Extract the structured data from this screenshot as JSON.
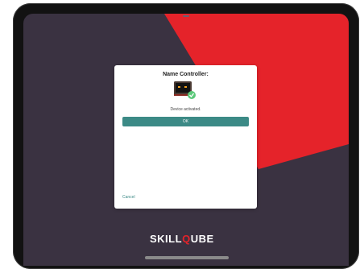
{
  "dialog": {
    "title": "Name Controller:",
    "status": "Device activated.",
    "ok_label": "OK",
    "cancel_label": "Cancel"
  },
  "brand": {
    "prefix": "SKILL",
    "q": "Q",
    "suffix": "UBE"
  },
  "colors": {
    "screen_background": "#3a3241",
    "accent_red": "#e5232a",
    "button_teal": "#3c8a86",
    "check_green": "#5cc97a"
  },
  "icons": {
    "controller": "controller-device-icon",
    "check": "check-circle-icon"
  }
}
